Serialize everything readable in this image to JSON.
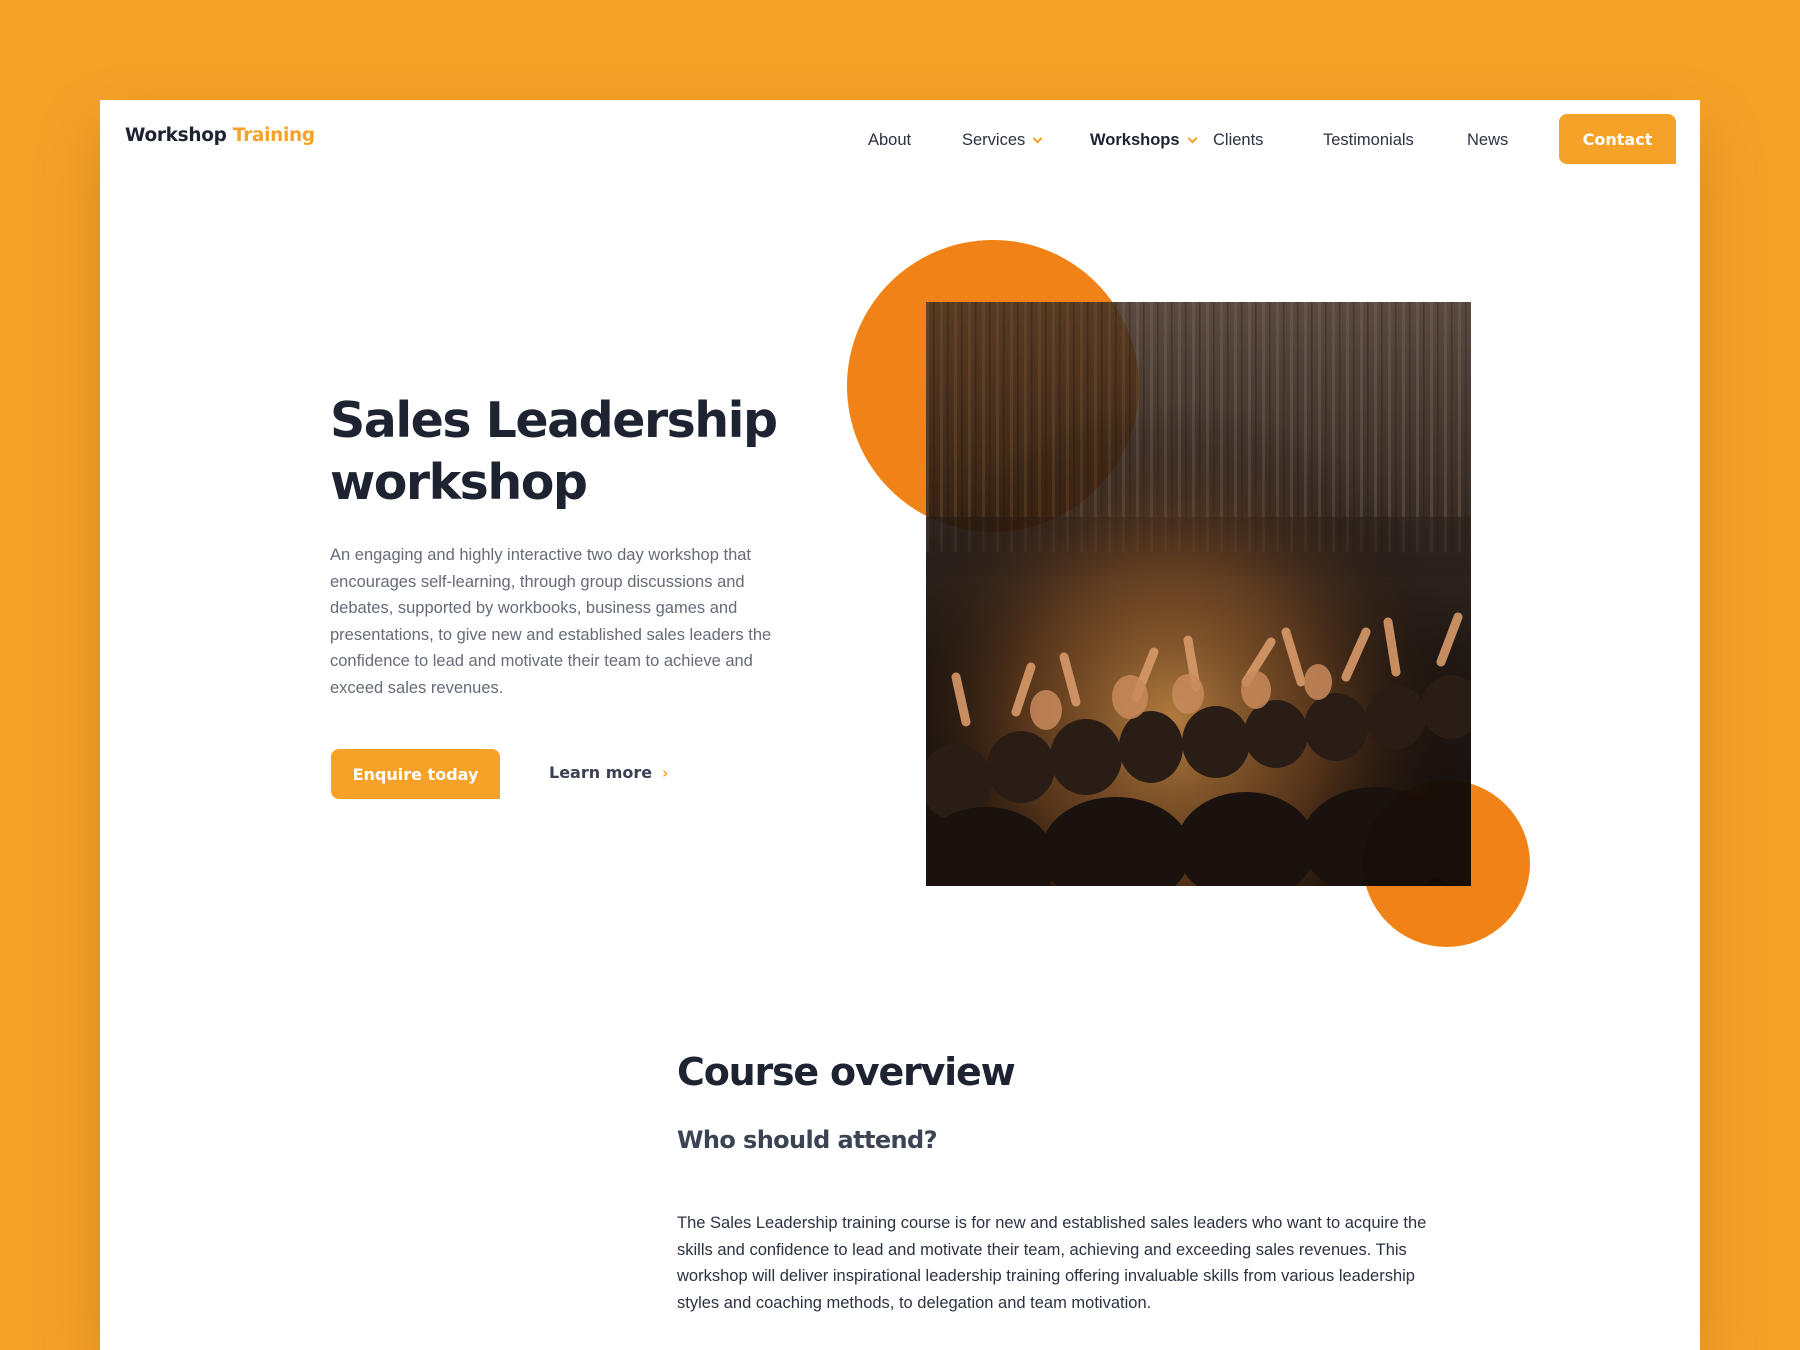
{
  "brand": {
    "name_part1": "Workshop",
    "name_part2": "Training",
    "accent_color": "#F6A229"
  },
  "nav": {
    "about": "About",
    "services": "Services",
    "workshops": "Workshops",
    "clients": "Clients",
    "testimonials": "Testimonials",
    "news": "News",
    "contact": "Contact",
    "active_item": "Workshops"
  },
  "hero": {
    "title_line1": "Sales Leadership",
    "title_line2": "workshop",
    "description": "An engaging and highly interactive two day workshop that encourages self-learning, through group discussions and debates, supported by workbooks, business games and presentations, to give new and established sales leaders the confidence to lead and motivate their team to achieve and exceed sales revenues.",
    "primary_button": "Enquire today",
    "secondary_link": "Learn more",
    "image_subject": "crowd-with-raised-hands-photo"
  },
  "overview": {
    "title": "Course overview",
    "subtitle": "Who should attend?",
    "body": "The Sales Leadership training course is for new and established sales leaders who want to acquire the skills and confidence to lead and motivate their team, achieving and exceeding sales revenues. This workshop will deliver inspirational leadership training offering invaluable skills from various leadership styles and coaching methods, to delegation and team motivation."
  }
}
